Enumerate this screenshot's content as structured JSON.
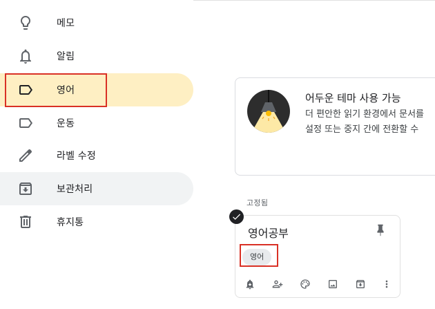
{
  "sidebar": {
    "items": [
      {
        "label": "메모",
        "icon": "lightbulb-icon"
      },
      {
        "label": "알림",
        "icon": "bell-icon"
      },
      {
        "label": "영어",
        "icon": "label-icon",
        "active": true
      },
      {
        "label": "운동",
        "icon": "label-icon"
      },
      {
        "label": "라벨 수정",
        "icon": "pencil-icon"
      },
      {
        "label": "보관처리",
        "icon": "archive-icon"
      },
      {
        "label": "휴지통",
        "icon": "trash-icon"
      }
    ]
  },
  "promo": {
    "title": "어두운 테마 사용 가능",
    "line1": "더 편안한 읽기 환경에서 문서를",
    "line2": "설정 또는 중지 간에 전환할 수"
  },
  "pinned": {
    "section_label": "고정됨",
    "note": {
      "title": "영어공부",
      "label_chip": "영어"
    }
  },
  "colors": {
    "active_bg": "#feefc3",
    "hover_bg": "#f1f3f4",
    "highlight_red": "#d93025"
  }
}
